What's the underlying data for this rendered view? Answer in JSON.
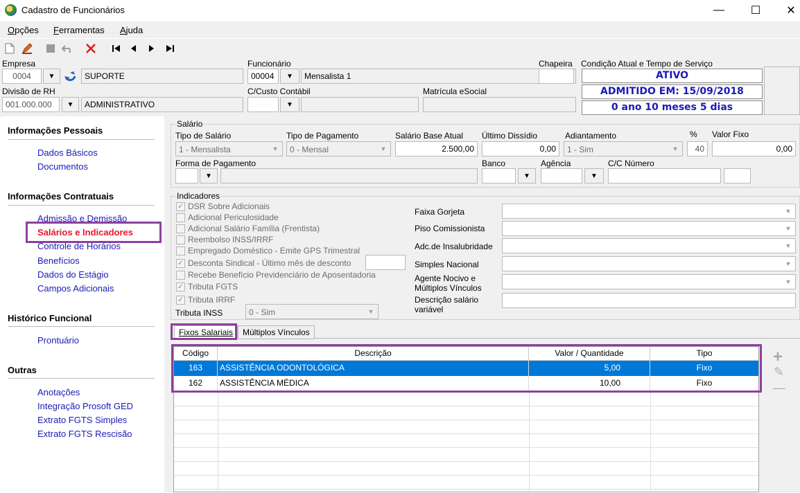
{
  "window": {
    "title": "Cadastro de Funcionários",
    "minimize": "—",
    "maximize": "☐",
    "close": "✕"
  },
  "menu": [
    {
      "label": "Opções",
      "u": "O",
      "rest": "pções"
    },
    {
      "label": "Ferramentas",
      "u": "F",
      "rest": "erramentas"
    },
    {
      "label": "Ajuda",
      "u": "A",
      "rest": "juda"
    }
  ],
  "header": {
    "empresa_label": "Empresa",
    "empresa_code": "0004",
    "empresa_name": "SUPORTE",
    "funcionario_label": "Funcionário",
    "funcionario_code": "00004",
    "funcionario_name": "Mensalista 1",
    "chapeira_label": "Chapeira",
    "chapeira_value": "",
    "condicao_label": "Condição Atual e Tempo de Serviço",
    "status": "ATIVO",
    "admitido": "ADMITIDO EM: 15/09/2018",
    "tempo": "0 ano 10 meses 5 dias",
    "divisao_label": "Divisão de RH",
    "divisao_code": "001.000.000",
    "divisao_name": "ADMINISTRATIVO",
    "ccusto_label": "C/Custo Contábil",
    "matricula_label": "Matrícula eSocial"
  },
  "sidebar": {
    "sections": [
      {
        "title": "Informações Pessoais",
        "items": [
          "Dados Básicos",
          "Documentos"
        ]
      },
      {
        "title": "Informações Contratuais",
        "items": [
          "Admissão e Demissão",
          "Salários e Indicadores",
          "Controle de Horários",
          "Benefícios",
          "Dados do Estágio",
          "Campos Adicionais"
        ]
      },
      {
        "title": "Histórico Funcional",
        "items": [
          "Prontuário"
        ]
      },
      {
        "title": "Outras",
        "items": [
          "Anotações",
          "Integração Prosoft GED",
          "Extrato FGTS Simples",
          "Extrato FGTS Rescisão"
        ]
      }
    ],
    "active_item": "Salários e Indicadores"
  },
  "salario": {
    "group_title": "Salário",
    "tipo_salario_label": "Tipo de Salário",
    "tipo_salario_value": "1 - Mensalista",
    "tipo_pagamento_label": "Tipo de Pagamento",
    "tipo_pagamento_value": "0 - Mensal",
    "salario_base_label": "Salário Base Atual",
    "salario_base_value": "2.500,00",
    "ultimo_dissidio_label": "Último Dissídio",
    "ultimo_dissidio_value": "0,00",
    "adiantamento_label": "Adiantamento",
    "adiantamento_value": "1 - Sim",
    "pct_label": "%",
    "pct_value": "40",
    "valor_fixo_label": "Valor Fixo",
    "valor_fixo_value": "0,00",
    "forma_pagamento_label": "Forma de Pagamento",
    "banco_label": "Banco",
    "agencia_label": "Agência",
    "cc_label": "C/C Número"
  },
  "indicadores": {
    "group_title": "Indicadores",
    "checks": [
      {
        "label": "DSR Sobre Adicionais",
        "checked": true
      },
      {
        "label": "Adicional Periculosidade",
        "checked": false
      },
      {
        "label": "Adicional Salário Família (Frentista)",
        "checked": false
      },
      {
        "label": "Reembolso INSS/IRRF",
        "checked": false
      },
      {
        "label": "Empregado Doméstico - Emite GPS Trimestral",
        "checked": false
      },
      {
        "label": "Desconta Sindical - Último mês de desconto",
        "checked": true
      },
      {
        "label": "Recebe Benefício Previdenciário de Aposentadoria",
        "checked": false
      },
      {
        "label": "Tributa FGTS",
        "checked": true
      },
      {
        "label": "Tributa IRRF",
        "checked": true
      }
    ],
    "tributa_inss_label": "Tributa INSS",
    "tributa_inss_value": "0 - Sim",
    "right_fields": [
      "Faixa Gorjeta",
      "Piso Comissionista",
      "Adc.de Insalubridade",
      "Simples Nacional"
    ],
    "agente_label_1": "Agente Nocivo e",
    "agente_label_2": "Múltiplos Vínculos",
    "descricao_label_1": "Descrição salário",
    "descricao_label_2": "variável"
  },
  "tabs": [
    "Fixos Salariais",
    "Múltiplos Vínculos"
  ],
  "grid": {
    "headers": [
      "Código",
      "Descrição",
      "Valor / Quantidade",
      "Tipo"
    ],
    "rows": [
      {
        "codigo": "163",
        "descricao": "ASSISTÊNCIA ODONTOLÓGICA",
        "valor": "5,00",
        "tipo": "Fixo"
      },
      {
        "codigo": "162",
        "descricao": "ASSISTÊNCIA MÉDICA",
        "valor": "10,00",
        "tipo": "Fixo"
      }
    ],
    "selected_row": 0
  },
  "side_actions": {
    "add": "+",
    "edit": "✎",
    "remove": "—"
  },
  "colors": {
    "accent_purple": "#8e3fa0",
    "link_blue": "#1a1ab8",
    "selected_blue": "#0078d7",
    "active_red": "#e8152b"
  }
}
